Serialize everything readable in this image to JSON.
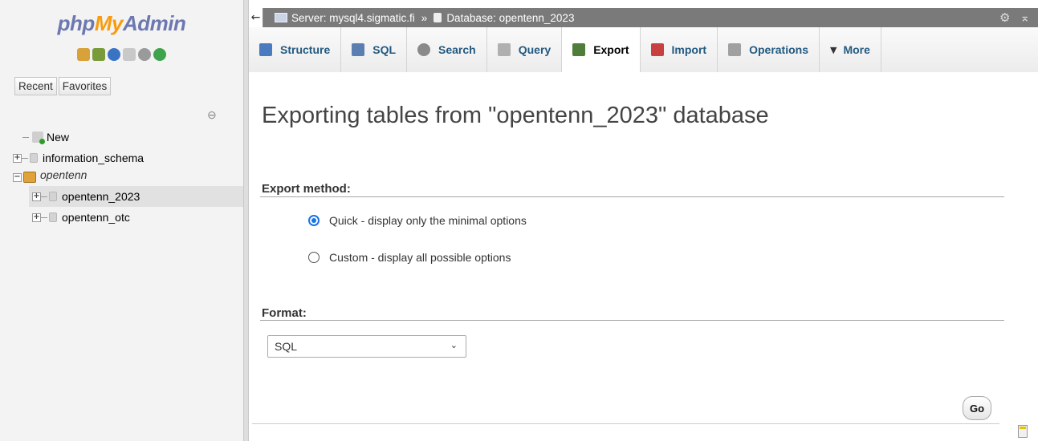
{
  "logo": {
    "php": "php",
    "my": "My",
    "admin": "Admin"
  },
  "quick_icons": [
    {
      "name": "home-icon",
      "color": "#d8a23a"
    },
    {
      "name": "logout-icon",
      "color": "#7a9b3a"
    },
    {
      "name": "help-icon",
      "color": "#3b73c4"
    },
    {
      "name": "docs-icon",
      "color": "#c9c9c9"
    },
    {
      "name": "settings-icon",
      "color": "#9a9a9a"
    },
    {
      "name": "reload-icon",
      "color": "#3fa34d"
    }
  ],
  "nav": {
    "tabs": [
      "Recent",
      "Favorites"
    ],
    "tree": {
      "new": "New",
      "information_schema": "information_schema",
      "group": "opentenn",
      "db1": "opentenn_2023",
      "db2": "opentenn_otc"
    }
  },
  "topbar": {
    "server_label": "Server: mysql4.sigmatic.fi",
    "separator": "»",
    "database_label": "Database: opentenn_2023"
  },
  "tabs": [
    {
      "label": "Structure",
      "color": "#4a7abf"
    },
    {
      "label": "SQL",
      "color": "#5a7fb0"
    },
    {
      "label": "Search",
      "color": "#8a8a8a"
    },
    {
      "label": "Query",
      "color": "#b0b0b0"
    },
    {
      "label": "Export",
      "color": "#4e7d3c"
    },
    {
      "label": "Import",
      "color": "#c84040"
    },
    {
      "label": "Operations",
      "color": "#a0a0a0"
    },
    {
      "label": "More",
      "color": "#333333"
    }
  ],
  "main": {
    "title": "Exporting tables from \"opentenn_2023\" database",
    "export_method_label": "Export method:",
    "quick_option": "Quick - display only the minimal options",
    "custom_option": "Custom - display all possible options",
    "format_label": "Format:",
    "format_value": "SQL",
    "go_button": "Go"
  },
  "colors": {
    "accent": "#1a73e8",
    "tab_link": "#235a81"
  }
}
